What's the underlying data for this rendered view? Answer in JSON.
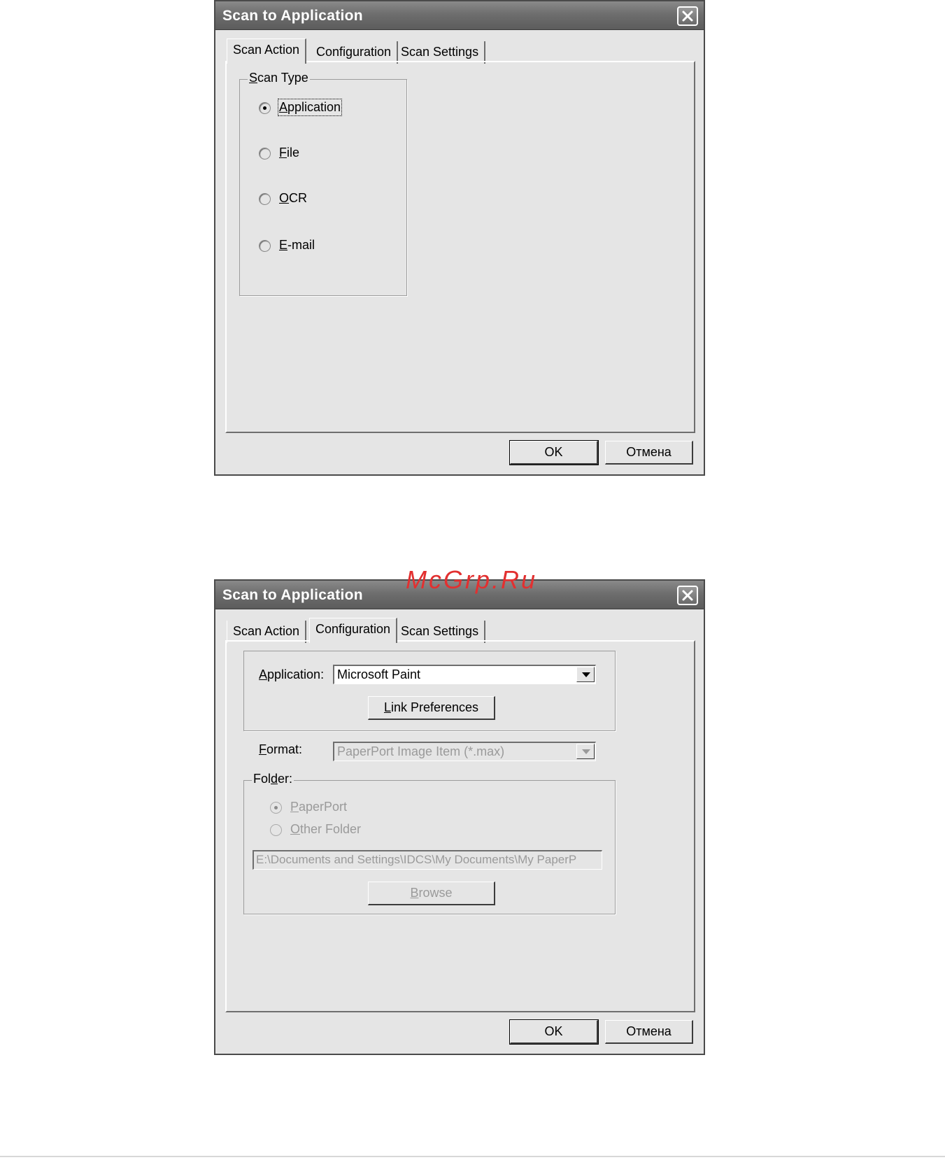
{
  "watermark": "McGrp.Ru",
  "dialog1": {
    "title": "Scan to Application",
    "tabs": [
      {
        "label": "Scan Action",
        "active": true
      },
      {
        "label": "Configuration",
        "active": false
      },
      {
        "label": "Scan Settings",
        "active": false
      }
    ],
    "scan_type": {
      "legend_key": "S",
      "legend_rest": "can Type",
      "options": [
        {
          "key": "A",
          "rest": "pplication",
          "checked": true
        },
        {
          "key": "F",
          "rest": "ile",
          "checked": false
        },
        {
          "key": "O",
          "rest": "CR",
          "checked": false
        },
        {
          "key": "E",
          "rest": "-mail",
          "checked": false
        }
      ]
    },
    "ok_label": "OK",
    "cancel_label": "Отмена"
  },
  "dialog2": {
    "title": "Scan to Application",
    "tabs": [
      {
        "label": "Scan Action",
        "active": false
      },
      {
        "label": "Configuration",
        "active": true
      },
      {
        "label": "Scan Settings",
        "active": false
      }
    ],
    "application_label_key": "A",
    "application_label_rest": "pplication:",
    "application_value": "Microsoft Paint",
    "link_prefs_key": "L",
    "link_prefs_rest": "ink Preferences",
    "format_label_key": "F",
    "format_label_rest": "ormat:",
    "format_value": "PaperPort Image Item (*.max)",
    "folder_legend_pre": "Fol",
    "folder_legend_key": "d",
    "folder_legend_post": "er:",
    "folder_options": [
      {
        "key": "P",
        "rest": "aperPort",
        "checked": true
      },
      {
        "key": "O",
        "rest": "ther Folder",
        "checked": false
      }
    ],
    "folder_path": "E:\\Documents and Settings\\IDCS\\My Documents\\My PaperP",
    "browse_key": "B",
    "browse_rest": "rowse",
    "ok_label": "OK",
    "cancel_label": "Отмена"
  }
}
